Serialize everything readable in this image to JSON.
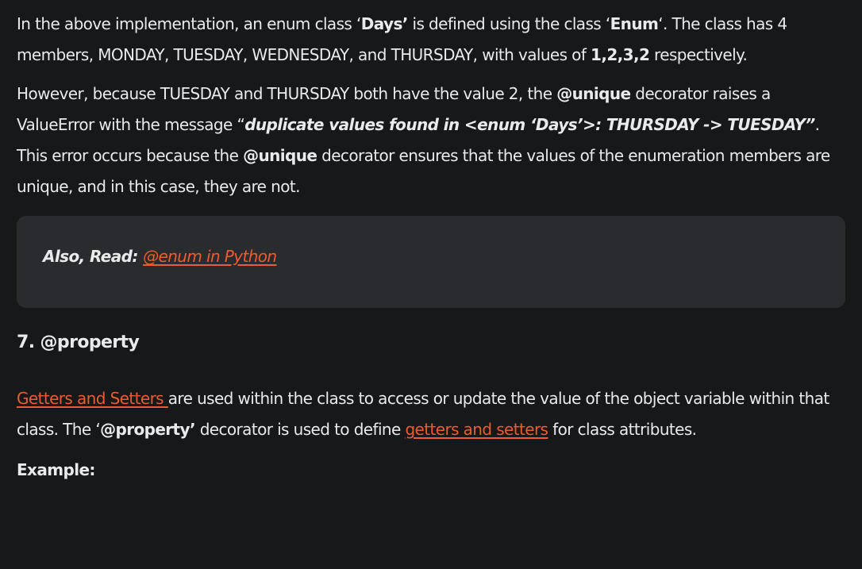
{
  "para1": {
    "t1": "In the above implementation, an enum class ‘",
    "b1": "Days’",
    "t2": " is defined using the class ‘",
    "b2": "Enum",
    "t3": "‘. The class has 4 members, MONDAY, TUESDAY, WEDNESDAY, and THURSDAY, with values of ",
    "b3": "1,2,3,2",
    "t4": " respectively."
  },
  "para2": {
    "t1": "However, because TUESDAY and THURSDAY both have the value 2, the ",
    "b1": "@unique",
    "t2": " decorator raises a ValueError with the message “",
    "bi1": "duplicate values found in <enum ‘Days’>: THURSDAY -> TUESDAY”",
    "t3": ". This error occurs because the ",
    "b2": "@unique",
    "t4": " decorator ensures that the values of the enumeration members are unique, and in this case, they are not."
  },
  "callout": {
    "prefix": "Also, Read: ",
    "link": "@enum in Python"
  },
  "section_heading": "7. @property",
  "para3": {
    "link1": "Getters and Setters ",
    "t1": "are used within the class to access or update the value of the object variable within that class. The ‘",
    "b1": "@property’",
    "t2": " decorator is used to define ",
    "link2": "getters and setters",
    "t3": " for class attributes."
  },
  "example_label": "Example:"
}
